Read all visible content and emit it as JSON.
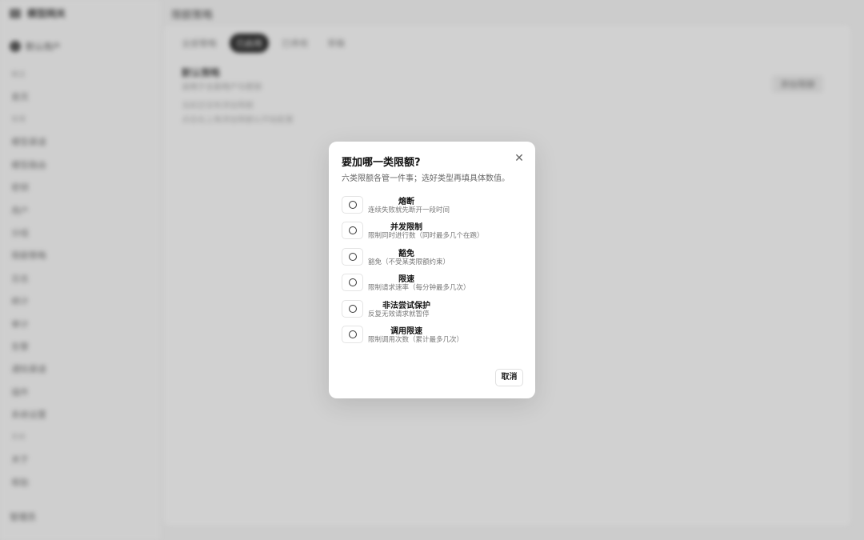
{
  "background": {
    "brand": "模型网关",
    "user": "默认用户",
    "page_title": "限额策略",
    "sidebar_items": [
      {
        "type": "section",
        "label": "概览"
      },
      {
        "type": "item",
        "label": "首页"
      },
      {
        "type": "section",
        "label": "管理"
      },
      {
        "type": "item",
        "label": "模型渠道"
      },
      {
        "type": "item",
        "label": "模型路由"
      },
      {
        "type": "item",
        "label": "密钥"
      },
      {
        "type": "item",
        "label": "用户"
      },
      {
        "type": "item",
        "label": "分组"
      },
      {
        "type": "item",
        "label": "限额策略"
      },
      {
        "type": "item",
        "label": "日志"
      },
      {
        "type": "item",
        "label": "统计"
      },
      {
        "type": "item",
        "label": "审计"
      },
      {
        "type": "item",
        "label": "告警"
      },
      {
        "type": "item",
        "label": "通知渠道"
      },
      {
        "type": "item",
        "label": "插件"
      },
      {
        "type": "item",
        "label": "系统设置"
      },
      {
        "type": "section",
        "label": "系统"
      },
      {
        "type": "item",
        "label": "关于"
      },
      {
        "type": "item",
        "label": "帮助"
      }
    ],
    "footer": "管理员",
    "tabs": [
      "全部策略",
      "已启用",
      "已停用",
      "草稿"
    ],
    "active_tab": 1,
    "card_title": "默认策略",
    "card_subtitle": "适用于全部用户与密钥",
    "card_body": [
      "当前还没有添加限额",
      "点击右上角添加限额以开始配置"
    ],
    "card_button": "添加限额"
  },
  "dialog": {
    "title": "要加哪一类限额?",
    "description": "六类限额各管一件事；选好类型再填具体数值。",
    "options": [
      {
        "title": "熔断",
        "subtitle": "连续失败就先断开一段时间"
      },
      {
        "title": "并发限制",
        "subtitle": "限制同时进行数（同时最多几个在跑）"
      },
      {
        "title": "豁免",
        "subtitle": "豁免（不受某类限额约束）"
      },
      {
        "title": "限速",
        "subtitle": "限制请求速率（每分钟最多几次）"
      },
      {
        "title": "非法尝试保护",
        "subtitle": "反复无效请求就暂停"
      },
      {
        "title": "调用限速",
        "subtitle": "限制调用次数（累计最多几次）"
      }
    ],
    "cancel_label": "取消"
  }
}
